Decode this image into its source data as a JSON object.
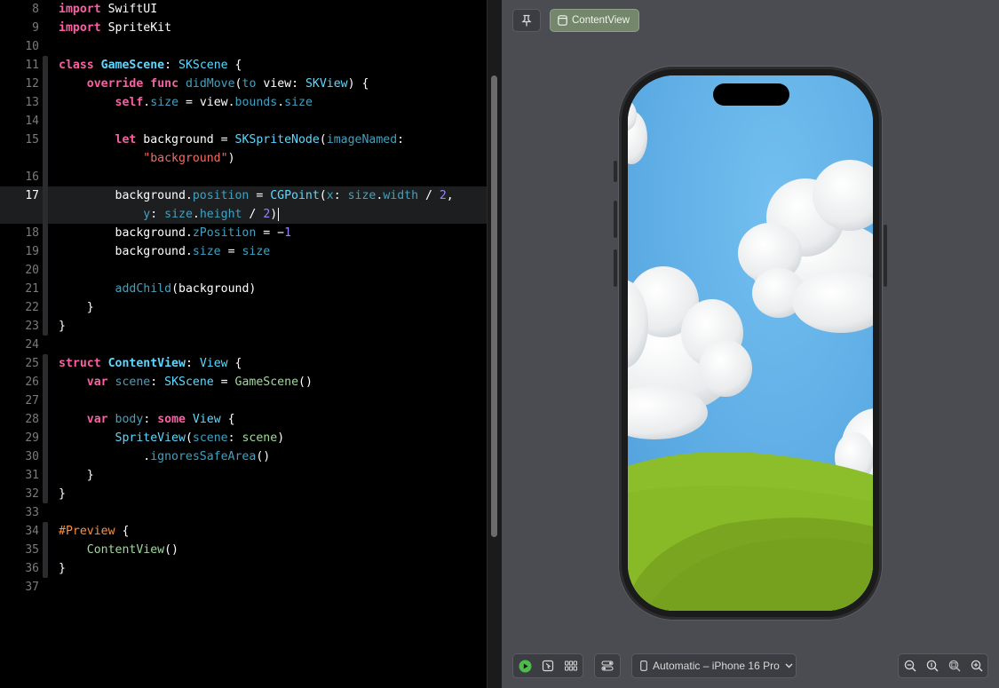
{
  "editor": {
    "active_line": 17,
    "lines": [
      {
        "n": "8",
        "tokens": [
          {
            "t": "import",
            "c": "kw"
          },
          {
            "t": " SwiftUI",
            "c": ""
          }
        ]
      },
      {
        "n": "9",
        "tokens": [
          {
            "t": "import",
            "c": "kw"
          },
          {
            "t": " SpriteKit",
            "c": ""
          }
        ]
      },
      {
        "n": "10",
        "tokens": []
      },
      {
        "n": "11",
        "tokens": [
          {
            "t": "class",
            "c": "kw"
          },
          {
            "t": " ",
            "c": ""
          },
          {
            "t": "GameScene",
            "c": "tyd"
          },
          {
            "t": ": ",
            "c": ""
          },
          {
            "t": "SKScene",
            "c": "ty"
          },
          {
            "t": " {",
            "c": ""
          }
        ]
      },
      {
        "n": "12",
        "tokens": [
          {
            "t": "    ",
            "c": ""
          },
          {
            "t": "override",
            "c": "kw"
          },
          {
            "t": " ",
            "c": ""
          },
          {
            "t": "func",
            "c": "kw"
          },
          {
            "t": " ",
            "c": ""
          },
          {
            "t": "didMove",
            "c": "fnc"
          },
          {
            "t": "(",
            "c": ""
          },
          {
            "t": "to",
            "c": "fnc"
          },
          {
            "t": " view: ",
            "c": ""
          },
          {
            "t": "SKView",
            "c": "ty"
          },
          {
            "t": ") {",
            "c": ""
          }
        ]
      },
      {
        "n": "13",
        "tokens": [
          {
            "t": "        ",
            "c": ""
          },
          {
            "t": "self",
            "c": "kw"
          },
          {
            "t": ".",
            "c": ""
          },
          {
            "t": "size",
            "c": "pr"
          },
          {
            "t": " = view.",
            "c": ""
          },
          {
            "t": "bounds",
            "c": "pr"
          },
          {
            "t": ".",
            "c": ""
          },
          {
            "t": "size",
            "c": "pr"
          }
        ]
      },
      {
        "n": "14",
        "tokens": []
      },
      {
        "n": "15",
        "tokens": [
          {
            "t": "        ",
            "c": ""
          },
          {
            "t": "let",
            "c": "kw"
          },
          {
            "t": " background = ",
            "c": ""
          },
          {
            "t": "SKSpriteNode",
            "c": "ty"
          },
          {
            "t": "(",
            "c": ""
          },
          {
            "t": "imageNamed",
            "c": "pr"
          },
          {
            "t": ":",
            "c": ""
          }
        ]
      },
      {
        "n": "",
        "tokens": [
          {
            "t": "            ",
            "c": ""
          },
          {
            "t": "\"background\"",
            "c": "str"
          },
          {
            "t": ")",
            "c": ""
          }
        ]
      },
      {
        "n": "16",
        "tokens": []
      },
      {
        "n": "17",
        "tokens": [
          {
            "t": "        background.",
            "c": ""
          },
          {
            "t": "position",
            "c": "pr"
          },
          {
            "t": " = ",
            "c": ""
          },
          {
            "t": "CGPoint",
            "c": "ty"
          },
          {
            "t": "(",
            "c": ""
          },
          {
            "t": "x",
            "c": "pr"
          },
          {
            "t": ": ",
            "c": ""
          },
          {
            "t": "size",
            "c": "pr"
          },
          {
            "t": ".",
            "c": ""
          },
          {
            "t": "width",
            "c": "pr"
          },
          {
            "t": " / ",
            "c": ""
          },
          {
            "t": "2",
            "c": "num2"
          },
          {
            "t": ",",
            "c": ""
          }
        ]
      },
      {
        "n": "",
        "tokens": [
          {
            "t": "            ",
            "c": ""
          },
          {
            "t": "y",
            "c": "pr"
          },
          {
            "t": ": ",
            "c": ""
          },
          {
            "t": "size",
            "c": "pr"
          },
          {
            "t": ".",
            "c": ""
          },
          {
            "t": "height",
            "c": "pr"
          },
          {
            "t": " / ",
            "c": ""
          },
          {
            "t": "2",
            "c": "num2"
          },
          {
            "t": ")",
            "c": ""
          }
        ]
      },
      {
        "n": "18",
        "tokens": [
          {
            "t": "        background.",
            "c": ""
          },
          {
            "t": "zPosition",
            "c": "pr"
          },
          {
            "t": " = −",
            "c": ""
          },
          {
            "t": "1",
            "c": "num2"
          }
        ]
      },
      {
        "n": "19",
        "tokens": [
          {
            "t": "        background.",
            "c": ""
          },
          {
            "t": "size",
            "c": "pr"
          },
          {
            "t": " = ",
            "c": ""
          },
          {
            "t": "size",
            "c": "pr"
          }
        ]
      },
      {
        "n": "20",
        "tokens": []
      },
      {
        "n": "21",
        "tokens": [
          {
            "t": "        ",
            "c": ""
          },
          {
            "t": "addChild",
            "c": "fnc"
          },
          {
            "t": "(background)",
            "c": ""
          }
        ]
      },
      {
        "n": "22",
        "tokens": [
          {
            "t": "    }",
            "c": ""
          }
        ]
      },
      {
        "n": "23",
        "tokens": [
          {
            "t": "}",
            "c": ""
          }
        ]
      },
      {
        "n": "24",
        "tokens": []
      },
      {
        "n": "25",
        "tokens": [
          {
            "t": "struct",
            "c": "kw"
          },
          {
            "t": " ",
            "c": ""
          },
          {
            "t": "ContentView",
            "c": "tyd"
          },
          {
            "t": ": ",
            "c": ""
          },
          {
            "t": "View",
            "c": "ty"
          },
          {
            "t": " {",
            "c": ""
          }
        ]
      },
      {
        "n": "26",
        "tokens": [
          {
            "t": "    ",
            "c": ""
          },
          {
            "t": "var",
            "c": "kw"
          },
          {
            "t": " ",
            "c": ""
          },
          {
            "t": "scene",
            "c": "fnc"
          },
          {
            "t": ": ",
            "c": ""
          },
          {
            "t": "SKScene",
            "c": "ty"
          },
          {
            "t": " = ",
            "c": ""
          },
          {
            "t": "GameScene",
            "c": "appcall"
          },
          {
            "t": "()",
            "c": ""
          }
        ]
      },
      {
        "n": "27",
        "tokens": []
      },
      {
        "n": "28",
        "tokens": [
          {
            "t": "    ",
            "c": ""
          },
          {
            "t": "var",
            "c": "kw"
          },
          {
            "t": " ",
            "c": ""
          },
          {
            "t": "body",
            "c": "fnc"
          },
          {
            "t": ": ",
            "c": ""
          },
          {
            "t": "some",
            "c": "kw"
          },
          {
            "t": " ",
            "c": ""
          },
          {
            "t": "View",
            "c": "ty"
          },
          {
            "t": " {",
            "c": ""
          }
        ]
      },
      {
        "n": "29",
        "tokens": [
          {
            "t": "        ",
            "c": ""
          },
          {
            "t": "SpriteView",
            "c": "ty"
          },
          {
            "t": "(",
            "c": ""
          },
          {
            "t": "scene",
            "c": "pr"
          },
          {
            "t": ": ",
            "c": ""
          },
          {
            "t": "scene",
            "c": "appcall"
          },
          {
            "t": ")",
            "c": ""
          }
        ]
      },
      {
        "n": "30",
        "tokens": [
          {
            "t": "            .",
            "c": ""
          },
          {
            "t": "ignoresSafeArea",
            "c": "pr"
          },
          {
            "t": "()",
            "c": ""
          }
        ]
      },
      {
        "n": "31",
        "tokens": [
          {
            "t": "    }",
            "c": ""
          }
        ]
      },
      {
        "n": "32",
        "tokens": [
          {
            "t": "}",
            "c": ""
          }
        ]
      },
      {
        "n": "33",
        "tokens": []
      },
      {
        "n": "34",
        "tokens": [
          {
            "t": "#Preview",
            "c": "pp"
          },
          {
            "t": " {",
            "c": ""
          }
        ]
      },
      {
        "n": "35",
        "tokens": [
          {
            "t": "    ",
            "c": ""
          },
          {
            "t": "ContentView",
            "c": "appcall"
          },
          {
            "t": "()",
            "c": ""
          }
        ]
      },
      {
        "n": "36",
        "tokens": [
          {
            "t": "}",
            "c": ""
          }
        ]
      },
      {
        "n": "37",
        "tokens": []
      }
    ]
  },
  "preview": {
    "tab_label": "ContentView",
    "device_label": "Automatic – iPhone 16 Pro",
    "icons": [
      "pin-icon",
      "live-play-icon",
      "selectable-icon",
      "grid-variants-icon",
      "device-settings-icon",
      "device-icon",
      "chevron-down-icon",
      "zoom-out-icon",
      "zoom-100-icon",
      "zoom-fit-icon",
      "zoom-in-icon"
    ]
  },
  "colors": {
    "editor_bg": "#000000",
    "canvas_bg": "#4a4c51",
    "tab_bg": "#74876d",
    "sky": "#5aaee8",
    "grass": "#8dbe2a"
  }
}
